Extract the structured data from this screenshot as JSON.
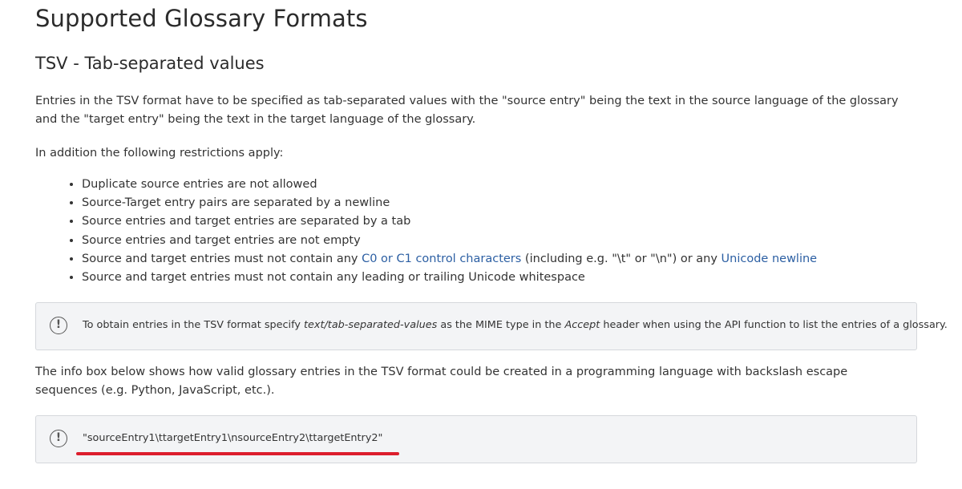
{
  "page": {
    "title": "Supported Glossary Formats",
    "section_title": "TSV - Tab-separated values",
    "intro_paragraph": "Entries in the TSV format have to be specified as tab-separated values with the \"source entry\" being the text in the source language of the glossary and the \"target entry\" being the text in the target language of the glossary.",
    "restrictions_intro": "In addition the following restrictions apply:",
    "restrictions": {
      "item1": "Duplicate source entries are not allowed",
      "item2": "Source-Target entry pairs are separated by a newline",
      "item3": "Source entries and target entries are separated by a tab",
      "item4": "Source entries and target entries are not empty",
      "item5_pre": "Source and target entries must not contain any ",
      "item5_link1": "C0 or C1 control characters",
      "item5_mid": " (including e.g. \"\\t\" or \"\\n\") or any ",
      "item5_link2": "Unicode newline",
      "item6": "Source and target entries must not contain any leading or trailing Unicode whitespace"
    },
    "info1": {
      "icon": "exclamation-circle-icon",
      "text_pre": "To obtain entries in the TSV format specify ",
      "text_em1": "text/tab-separated-values",
      "text_mid": " as the MIME type in the ",
      "text_em2": "Accept",
      "text_post": " header when using the API function to list the entries of a glossary."
    },
    "example_paragraph": "The info box below shows how valid glossary entries in the TSV format could be created in a programming language with backslash escape sequences (e.g. Python, JavaScript, etc.).",
    "info2": {
      "icon": "exclamation-circle-icon",
      "code": "\"sourceEntry1\\ttargetEntry1\\nsourceEntry2\\ttargetEntry2\""
    }
  },
  "colors": {
    "link": "#2c5fa3",
    "infobox_bg": "#f3f4f6",
    "infobox_border": "#d5d8dc",
    "highlight_underline": "#dc1e2d"
  }
}
